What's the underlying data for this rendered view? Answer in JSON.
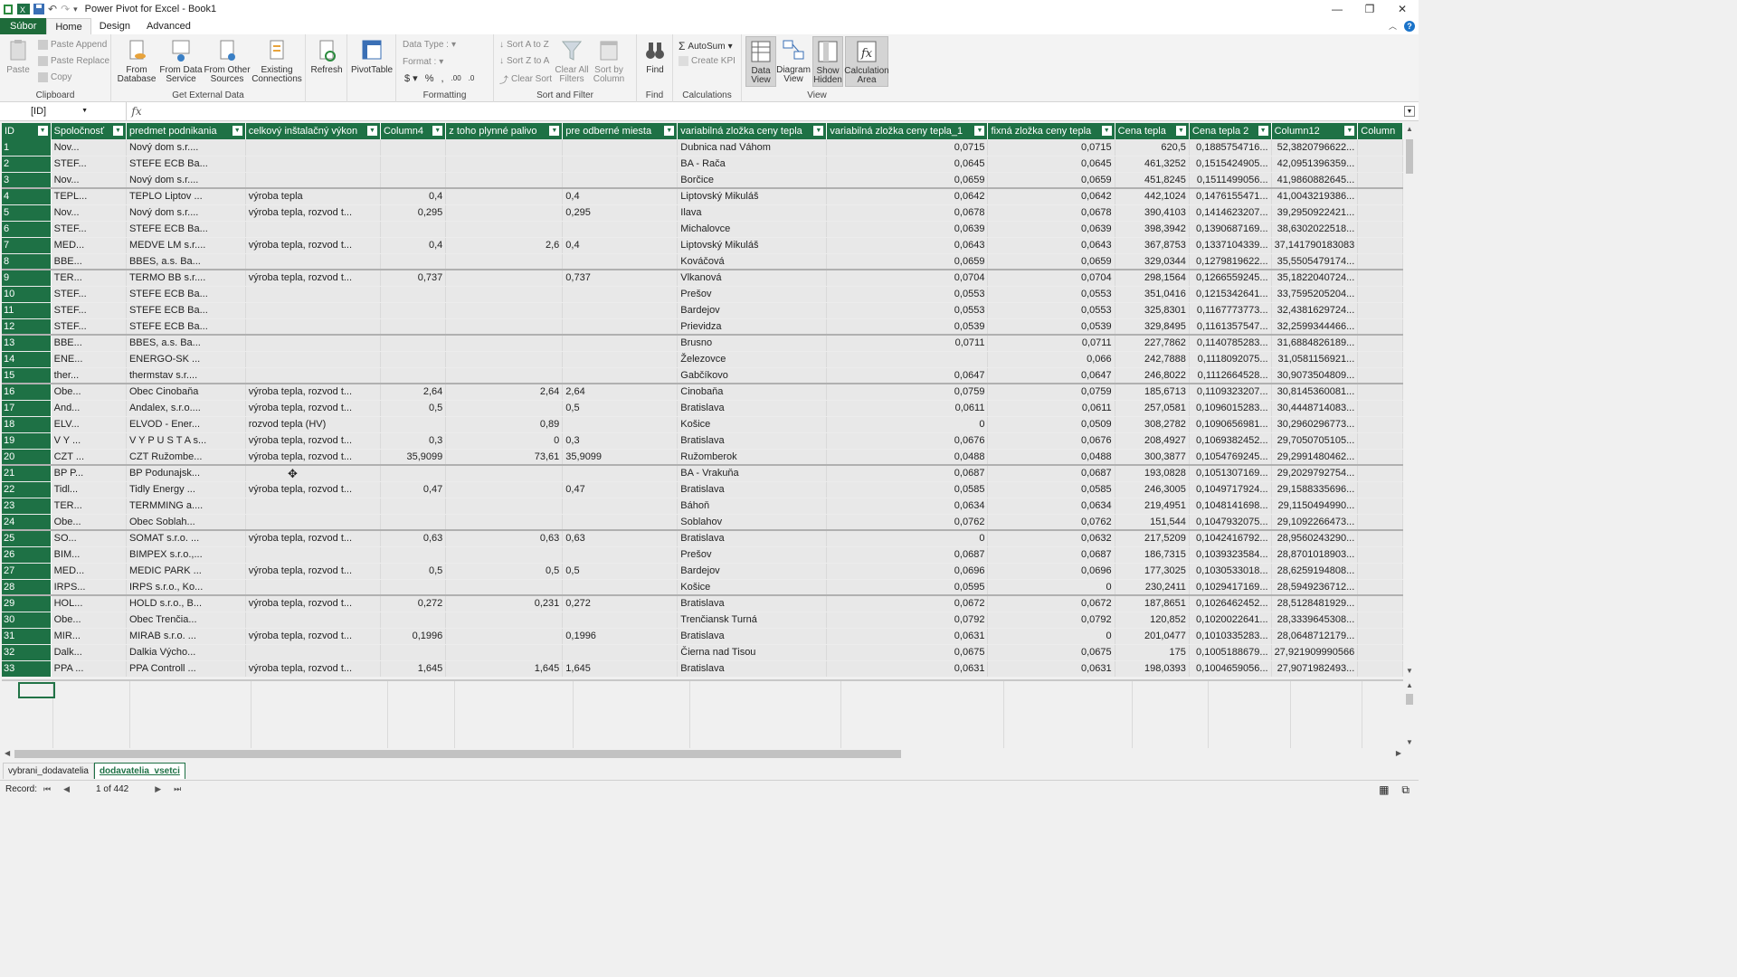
{
  "titlebar": {
    "title": "Power Pivot for Excel - Book1"
  },
  "tabs": [
    {
      "label": "Súbor",
      "type": "file"
    },
    {
      "label": "Home",
      "type": "active"
    },
    {
      "label": "Design",
      "type": "normal"
    },
    {
      "label": "Advanced",
      "type": "normal"
    }
  ],
  "ribbon": {
    "clipboard": {
      "label": "Clipboard",
      "paste": "Paste",
      "paste_append": "Paste Append",
      "paste_replace": "Paste Replace",
      "copy": "Copy"
    },
    "external": {
      "label": "Get External Data",
      "from_database": "From Database",
      "from_data_service": "From Data Service",
      "from_other_sources": "From Other Sources",
      "existing_connections": "Existing Connections"
    },
    "refresh": "Refresh",
    "pivottable": "PivotTable",
    "formatting": {
      "label": "Formatting",
      "data_type": "Data Type :",
      "format": "Format :"
    },
    "sort": {
      "label": "Sort and Filter",
      "sort_az": "Sort A to Z",
      "sort_za": "Sort Z to A",
      "clear_sort": "Clear Sort",
      "clear_filters": "Clear All Filters",
      "sort_by_column": "Sort by Column"
    },
    "find": {
      "label": "Find",
      "button": "Find"
    },
    "calculations": {
      "label": "Calculations",
      "autosum": "AutoSum",
      "create_kpi": "Create KPI"
    },
    "view": {
      "label": "View",
      "data_view": "Data View",
      "diagram_view": "Diagram View",
      "show_hidden": "Show Hidden",
      "calculation_area": "Calculation Area"
    }
  },
  "formula_bar": {
    "name_box": "[ID]",
    "fx": "fx",
    "formula": ""
  },
  "columns": [
    "ID",
    "Spoločnosť",
    "predmet podnikania",
    "celkový inštalačný výkon",
    "Column4",
    "z toho plynné palivo",
    "pre odberné miesta",
    "variabilná zložka ceny tepla",
    "variabilná zložka ceny tepla_1",
    "fixná zložka ceny tepla",
    "Cena tepla",
    "Cena tepla 2",
    "Column12",
    "Column"
  ],
  "rows": [
    [
      "1",
      "Nov...",
      "Nový dom s.r....",
      "",
      "",
      "",
      "",
      "Dubnica nad Váhom",
      "0,0715",
      "0,0715",
      "620,5",
      "0,1885754716...",
      "52,3820796622...",
      ""
    ],
    [
      "2",
      "STEF...",
      "STEFE ECB Ba...",
      "",
      "",
      "",
      "",
      "BA - Rača",
      "0,0645",
      "0,0645",
      "461,3252",
      "0,1515424905...",
      "42,0951396359...",
      ""
    ],
    [
      "3",
      "Nov...",
      "Nový dom s.r....",
      "",
      "",
      "",
      "",
      "Borčice",
      "0,0659",
      "0,0659",
      "451,8245",
      "0,1511499056...",
      "41,9860882645...",
      ""
    ],
    [
      "4",
      "TEPL...",
      "TEPLO Liptov ...",
      "výroba tepla",
      "0,4",
      "",
      "0,4",
      "Liptovský Mikuláš",
      "0,0642",
      "0,0642",
      "442,1024",
      "0,1476155471...",
      "41,0043219386...",
      ""
    ],
    [
      "5",
      "Nov...",
      "Nový dom s.r....",
      "výroba tepla, rozvod t...",
      "0,295",
      "",
      "0,295",
      "Ilava",
      "0,0678",
      "0,0678",
      "390,4103",
      "0,1414623207...",
      "39,2950922421...",
      ""
    ],
    [
      "6",
      "STEF...",
      "STEFE ECB Ba...",
      "",
      "",
      "",
      "",
      "Michalovce",
      "0,0639",
      "0,0639",
      "398,3942",
      "0,1390687169...",
      "38,6302022518...",
      ""
    ],
    [
      "7",
      "MED...",
      "MEDVE LM s.r....",
      "výroba tepla, rozvod t...",
      "0,4",
      "2,6",
      "0,4",
      "Liptovský Mikuláš",
      "0,0643",
      "0,0643",
      "367,8753",
      "0,1337104339...",
      "37,141790183083",
      ""
    ],
    [
      "8",
      "BBE...",
      "BBES, a.s. Ba...",
      "",
      "",
      "",
      "",
      "Kováčová",
      "0,0659",
      "0,0659",
      "329,0344",
      "0,1279819622...",
      "35,5505479174...",
      ""
    ],
    [
      "9",
      "TER...",
      "TERMO BB s.r....",
      "výroba tepla, rozvod t...",
      "0,737",
      "",
      "0,737",
      "Vlkanová",
      "0,0704",
      "0,0704",
      "298,1564",
      "0,1266559245...",
      "35,1822040724...",
      ""
    ],
    [
      "10",
      "STEF...",
      "STEFE ECB Ba...",
      "",
      "",
      "",
      "",
      "Prešov",
      "0,0553",
      "0,0553",
      "351,0416",
      "0,1215342641...",
      "33,7595205204...",
      ""
    ],
    [
      "11",
      "STEF...",
      "STEFE ECB Ba...",
      "",
      "",
      "",
      "",
      "Bardejov",
      "0,0553",
      "0,0553",
      "325,8301",
      "0,1167773773...",
      "32,4381629724...",
      ""
    ],
    [
      "12",
      "STEF...",
      "STEFE ECB Ba...",
      "",
      "",
      "",
      "",
      "Prievidza",
      "0,0539",
      "0,0539",
      "329,8495",
      "0,1161357547...",
      "32,2599344466...",
      ""
    ],
    [
      "13",
      "BBE...",
      "BBES, a.s. Ba...",
      "",
      "",
      "",
      "",
      "Brusno",
      "0,0711",
      "0,0711",
      "227,7862",
      "0,1140785283...",
      "31,6884826189...",
      ""
    ],
    [
      "14",
      "ENE...",
      "ENERGO-SK ...",
      "",
      "",
      "",
      "",
      "Železovce",
      "",
      "0,066",
      "242,7888",
      "0,1118092075...",
      "31,0581156921...",
      ""
    ],
    [
      "15",
      "ther...",
      "thermstav s.r....",
      "",
      "",
      "",
      "",
      "Gabčíkovo",
      "0,0647",
      "0,0647",
      "246,8022",
      "0,1112664528...",
      "30,9073504809...",
      ""
    ],
    [
      "16",
      "Obe...",
      "Obec Cinobaňa",
      "výroba tepla, rozvod t...",
      "2,64",
      "2,64",
      "2,64",
      "Cinobaňa",
      "0,0759",
      "0,0759",
      "185,6713",
      "0,1109323207...",
      "30,8145360081...",
      ""
    ],
    [
      "17",
      "And...",
      "Andalex, s.r.o....",
      "výroba tepla, rozvod t...",
      "0,5",
      "",
      "0,5",
      "Bratislava",
      "0,0611",
      "0,0611",
      "257,0581",
      "0,1096015283...",
      "30,4448714083...",
      ""
    ],
    [
      "18",
      "ELV...",
      "ELVOD - Ener...",
      "rozvod tepla (HV)",
      "",
      "0,89",
      "",
      "Košice",
      "0",
      "0,0509",
      "308,2782",
      "0,1090656981...",
      "30,2960296773...",
      ""
    ],
    [
      "19",
      "V Y ...",
      "V Y P U S T A s...",
      "výroba tepla, rozvod t...",
      "0,3",
      "0",
      "0,3",
      "Bratislava",
      "0,0676",
      "0,0676",
      "208,4927",
      "0,1069382452...",
      "29,7050705105...",
      ""
    ],
    [
      "20",
      "CZT ...",
      "CZT Ružombe...",
      "výroba tepla, rozvod t...",
      "35,9099",
      "73,61",
      "35,9099",
      "Ružomberok",
      "0,0488",
      "0,0488",
      "300,3877",
      "0,1054769245...",
      "29,2991480462...",
      ""
    ],
    [
      "21",
      "BP P...",
      "BP Podunajsk...",
      "",
      "",
      "",
      "",
      "BA - Vrakuňa",
      "0,0687",
      "0,0687",
      "193,0828",
      "0,1051307169...",
      "29,2029792754...",
      ""
    ],
    [
      "22",
      "Tidl...",
      "Tidly Energy ...",
      "výroba tepla, rozvod t...",
      "0,47",
      "",
      "0,47",
      "Bratislava",
      "0,0585",
      "0,0585",
      "246,3005",
      "0,1049717924...",
      "29,1588335696...",
      ""
    ],
    [
      "23",
      "TER...",
      "TERMMING a....",
      "",
      "",
      "",
      "",
      "Báhoň",
      "0,0634",
      "0,0634",
      "219,4951",
      "0,1048141698...",
      "29,1150494990...",
      ""
    ],
    [
      "24",
      "Obe...",
      "Obec Soblah...",
      "",
      "",
      "",
      "",
      "Soblahov",
      "0,0762",
      "0,0762",
      "151,544",
      "0,1047932075...",
      "29,1092266473...",
      ""
    ],
    [
      "25",
      "SO...",
      "SOMAT s.r.o. ...",
      "výroba tepla, rozvod t...",
      "0,63",
      "0,63",
      "0,63",
      "Bratislava",
      "0",
      "0,0632",
      "217,5209",
      "0,1042416792...",
      "28,9560243290...",
      ""
    ],
    [
      "26",
      "BIM...",
      "BIMPEX s.r.o.,...",
      "",
      "",
      "",
      "",
      "Prešov",
      "0,0687",
      "0,0687",
      "186,7315",
      "0,1039323584...",
      "28,8701018903...",
      ""
    ],
    [
      "27",
      "MED...",
      "MEDIC PARK ...",
      "výroba tepla, rozvod t...",
      "0,5",
      "0,5",
      "0,5",
      "Bardejov",
      "0,0696",
      "0,0696",
      "177,3025",
      "0,1030533018...",
      "28,6259194808...",
      ""
    ],
    [
      "28",
      "IRPS...",
      "IRPS s.r.o., Ko...",
      "",
      "",
      "",
      "",
      "Košice",
      "0,0595",
      "0",
      "230,2411",
      "0,1029417169...",
      "28,5949236712...",
      ""
    ],
    [
      "29",
      "HOL...",
      "HOLD s.r.o., B...",
      "výroba tepla, rozvod t...",
      "0,272",
      "0,231",
      "0,272",
      "Bratislava",
      "0,0672",
      "0,0672",
      "187,8651",
      "0,1026462452...",
      "28,5128481929...",
      ""
    ],
    [
      "30",
      "Obe...",
      "Obec Trenčia...",
      "",
      "",
      "",
      "",
      "Trenčiansk Turná",
      "0,0792",
      "0,0792",
      "120,852",
      "0,1020022641...",
      "28,3339645308...",
      ""
    ],
    [
      "31",
      "MIR...",
      "MIRAB s.r.o. ...",
      "výroba tepla, rozvod t...",
      "0,1996",
      "",
      "0,1996",
      "Bratislava",
      "0,0631",
      "0",
      "201,0477",
      "0,1010335283...",
      "28,0648712179...",
      ""
    ],
    [
      "32",
      "Dalk...",
      "Dalkia Výcho...",
      "",
      "",
      "",
      "",
      "Čierna nad Tisou",
      "0,0675",
      "0,0675",
      "175",
      "0,1005188679...",
      "27,921909990566",
      ""
    ],
    [
      "33",
      "PPA ...",
      "PPA Controll ...",
      "výroba tepla, rozvod t...",
      "1,645",
      "1,645",
      "1,645",
      "Bratislava",
      "0,0631",
      "0,0631",
      "198,0393",
      "0,1004659056...",
      "27,9071982493...",
      ""
    ]
  ],
  "sheets": [
    {
      "label": "vybrani_dodavatelia",
      "active": false
    },
    {
      "label": "dodavatelia_vsetci",
      "active": true
    }
  ],
  "status": {
    "record_label": "Record:",
    "record_value": "1 of 442"
  }
}
